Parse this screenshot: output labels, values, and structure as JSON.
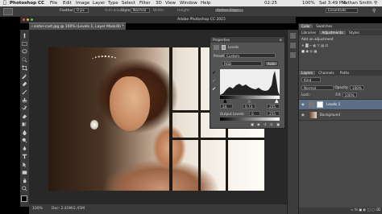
{
  "mac_menu": {
    "app": "Photoshop CC",
    "items": [
      "File",
      "Edit",
      "Image",
      "Layer",
      "Type",
      "Select",
      "Filter",
      "3D",
      "View",
      "Window",
      "Help"
    ],
    "clock": "02:25",
    "date_time": "Sat 3:49 PM",
    "user": "Nathan Smith",
    "battery": "100%"
  },
  "options_bar": {
    "feather_label": "Feather:",
    "feather_value": "0 px",
    "antialias_label": "Anti-alias",
    "style_label": "Style:",
    "style_value": "Normal",
    "width_label": "Width:",
    "height_label": "Height:",
    "refine_label": "Refine Edge...",
    "workspace": "Essentials"
  },
  "app_title": "Adobe Photoshop CC 2015",
  "document_tab": "sister-cast.jpg @ 100% (Levels 1, Layer Mask/8) *",
  "status": {
    "zoom": "100%",
    "doc": "Doc: 2.45M/2.45M"
  },
  "properties": {
    "title": "Properties",
    "panel_name": "Levels",
    "preset_label": "Preset:",
    "preset_value": "Custom",
    "channel_value": "RGB",
    "auto_label": "Auto",
    "input_values": [
      "24",
      "0.73",
      "255"
    ],
    "output_label": "Output Levels:",
    "output_values": [
      "0",
      "255"
    ]
  },
  "right_panel": {
    "top_tabs": [
      "Color",
      "Swatches"
    ],
    "adj_tabs": [
      "Libraries",
      "Adjustments",
      "Styles"
    ],
    "add_adjustment": "Add an adjustment",
    "layer_tabs": [
      "Layers",
      "Channels",
      "Paths"
    ],
    "kind_label": "Kind",
    "blend_mode": "Normal",
    "opacity_label": "Opacity:",
    "opacity_value": "100%",
    "lock_label": "Lock:",
    "fill_label": "Fill:",
    "fill_value": "100%",
    "layers": [
      {
        "name": "Levels 1",
        "type": "adjustment"
      },
      {
        "name": "Background",
        "type": "image"
      }
    ]
  },
  "colors": {
    "accent": "#2d6fb3",
    "panel": "#484848",
    "toolbar": "#3a3a3a"
  }
}
